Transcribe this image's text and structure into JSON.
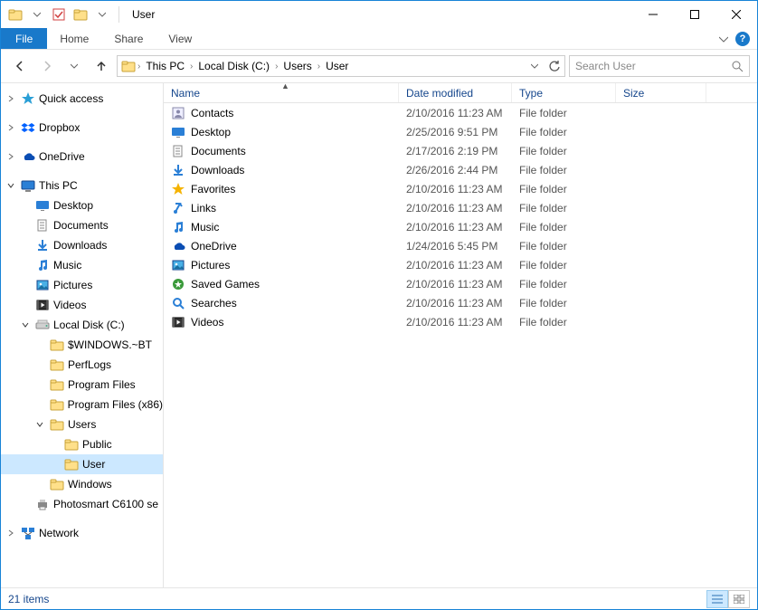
{
  "window": {
    "title": "User"
  },
  "ribbon": {
    "file": "File",
    "tabs": [
      "Home",
      "Share",
      "View"
    ]
  },
  "breadcrumb": [
    "This PC",
    "Local Disk (C:)",
    "Users",
    "User"
  ],
  "search": {
    "placeholder": "Search User"
  },
  "columns": {
    "name": "Name",
    "date": "Date modified",
    "type": "Type",
    "size": "Size"
  },
  "nav": {
    "pinned": [
      {
        "label": "Quick access",
        "icon": "star-blue",
        "expander": "chev"
      },
      {
        "label": "Dropbox",
        "icon": "dropbox",
        "expander": "chev"
      },
      {
        "label": "OneDrive",
        "icon": "onedrive",
        "expander": "chev"
      }
    ],
    "thispc": {
      "label": "This PC",
      "icon": "monitor",
      "expander": "chev-open"
    },
    "thispc_children": [
      {
        "label": "Desktop",
        "icon": "desktop",
        "indent": 1
      },
      {
        "label": "Documents",
        "icon": "documents",
        "indent": 1
      },
      {
        "label": "Downloads",
        "icon": "downloads",
        "indent": 1
      },
      {
        "label": "Music",
        "icon": "music",
        "indent": 1
      },
      {
        "label": "Pictures",
        "icon": "pictures",
        "indent": 1
      },
      {
        "label": "Videos",
        "icon": "videos",
        "indent": 1
      },
      {
        "label": "Local Disk (C:)",
        "icon": "drive",
        "indent": 1,
        "expander": "chev-open"
      },
      {
        "label": "$WINDOWS.~BT",
        "icon": "folder",
        "indent": 2
      },
      {
        "label": "PerfLogs",
        "icon": "folder",
        "indent": 2
      },
      {
        "label": "Program Files",
        "icon": "folder",
        "indent": 2
      },
      {
        "label": "Program Files (x86)",
        "icon": "folder",
        "indent": 2
      },
      {
        "label": "Users",
        "icon": "folder",
        "indent": 2,
        "expander": "chev-open"
      },
      {
        "label": "Public",
        "icon": "folder",
        "indent": 3
      },
      {
        "label": "User",
        "icon": "folder",
        "indent": 3,
        "selected": true
      },
      {
        "label": "Windows",
        "icon": "folder",
        "indent": 2
      },
      {
        "label": "Photosmart C6100 se",
        "icon": "printer",
        "indent": 1
      }
    ],
    "network": {
      "label": "Network",
      "icon": "network",
      "expander": "chev"
    }
  },
  "files": [
    {
      "name": "Contacts",
      "icon": "contacts",
      "date": "2/10/2016 11:23 AM",
      "type": "File folder"
    },
    {
      "name": "Desktop",
      "icon": "desktop",
      "date": "2/25/2016 9:51 PM",
      "type": "File folder"
    },
    {
      "name": "Documents",
      "icon": "documents",
      "date": "2/17/2016 2:19 PM",
      "type": "File folder"
    },
    {
      "name": "Downloads",
      "icon": "downloads",
      "date": "2/26/2016 2:44 PM",
      "type": "File folder"
    },
    {
      "name": "Favorites",
      "icon": "favorites",
      "date": "2/10/2016 11:23 AM",
      "type": "File folder"
    },
    {
      "name": "Links",
      "icon": "links",
      "date": "2/10/2016 11:23 AM",
      "type": "File folder"
    },
    {
      "name": "Music",
      "icon": "music",
      "date": "2/10/2016 11:23 AM",
      "type": "File folder"
    },
    {
      "name": "OneDrive",
      "icon": "onedrive",
      "date": "1/24/2016 5:45 PM",
      "type": "File folder"
    },
    {
      "name": "Pictures",
      "icon": "pictures",
      "date": "2/10/2016 11:23 AM",
      "type": "File folder"
    },
    {
      "name": "Saved Games",
      "icon": "games",
      "date": "2/10/2016 11:23 AM",
      "type": "File folder"
    },
    {
      "name": "Searches",
      "icon": "searches",
      "date": "2/10/2016 11:23 AM",
      "type": "File folder"
    },
    {
      "name": "Videos",
      "icon": "videos",
      "date": "2/10/2016 11:23 AM",
      "type": "File folder"
    }
  ],
  "status": {
    "count": "21 items"
  }
}
